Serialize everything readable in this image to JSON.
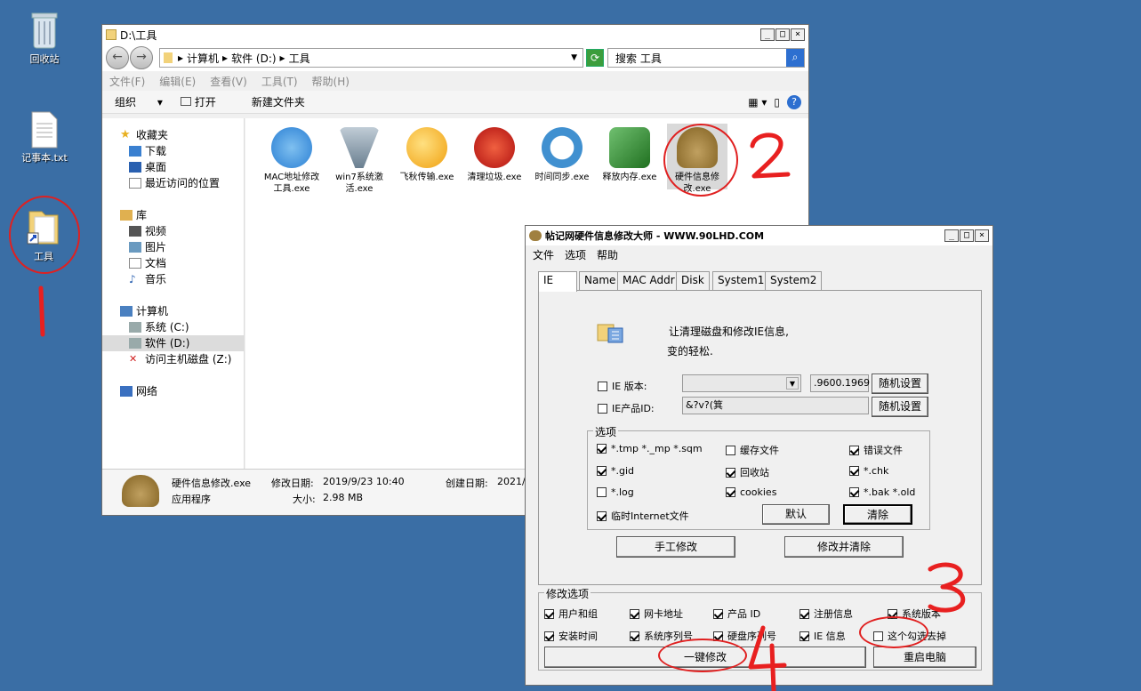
{
  "desktop": {
    "icons": [
      {
        "label": "回收站"
      },
      {
        "label": "记事本.txt"
      },
      {
        "label": "工具"
      }
    ]
  },
  "explorer": {
    "title": "D:\\工具",
    "breadcrumb": [
      "计算机",
      "软件 (D:)",
      "工具"
    ],
    "search_placeholder": "搜索 工具",
    "menu": [
      "文件(F)",
      "编辑(E)",
      "查看(V)",
      "工具(T)",
      "帮助(H)"
    ],
    "toolbar": {
      "organize": "组织",
      "open": "打开",
      "new_folder": "新建文件夹"
    },
    "nav": {
      "favorites": "收藏夹",
      "fav_items": [
        "下载",
        "桌面",
        "最近访问的位置"
      ],
      "libraries": "库",
      "lib_items": [
        "视频",
        "图片",
        "文档",
        "音乐"
      ],
      "computer": "计算机",
      "drives": [
        "系统 (C:)",
        "软件 (D:)",
        "访问主机磁盘 (Z:)"
      ],
      "network": "网络"
    },
    "files": [
      {
        "name": "MAC地址修改工具.exe",
        "color": "#2a7fd4"
      },
      {
        "name": "win7系统激活.exe",
        "color": "#7a8fa0"
      },
      {
        "name": "飞秋传输.exe",
        "color": "#f0b020"
      },
      {
        "name": "清理垃圾.exe",
        "color": "#d03020"
      },
      {
        "name": "时间同步.exe",
        "color": "#4090d0"
      },
      {
        "name": "释放内存.exe",
        "color": "#40a040"
      },
      {
        "name": "硬件信息修改.exe",
        "color": "#a08040"
      }
    ],
    "status": {
      "filename": "硬件信息修改.exe",
      "modified_label": "修改日期:",
      "modified": "2019/9/23 10:40",
      "created_label": "创建日期:",
      "created": "2021/",
      "type": "应用程序",
      "size_label": "大小:",
      "size": "2.98 MB"
    }
  },
  "tool": {
    "title": "帖记网硬件信息修改大师 - WWW.90LHD.COM",
    "menu": [
      "文件",
      "选项",
      "帮助"
    ],
    "tabs": [
      "IE",
      "Name",
      "MAC Addr",
      "Disk",
      "System1",
      "System2"
    ],
    "intro_line1": "让清理磁盘和修改IE信息,",
    "intro_line2": "变的轻松.",
    "ie_version_label": "IE 版本:",
    "ie_version_value": ".9600.1969",
    "ie_product_label": "IE产品ID:",
    "ie_product_value": "&?v?(箕",
    "random_btn": "随机设置",
    "options_legend": "选项",
    "options": [
      {
        "label": "*.tmp  *._mp  *.sqm",
        "checked": true
      },
      {
        "label": "缓存文件",
        "checked": false
      },
      {
        "label": "错误文件",
        "checked": true
      },
      {
        "label": "*.gid",
        "checked": true
      },
      {
        "label": "回收站",
        "checked": true
      },
      {
        "label": "*.chk",
        "checked": true
      },
      {
        "label": "*.log",
        "checked": false
      },
      {
        "label": "cookies",
        "checked": true
      },
      {
        "label": "*.bak  *.old",
        "checked": true
      },
      {
        "label": "临时Internet文件",
        "checked": true
      }
    ],
    "default_btn": "默认",
    "clear_btn": "清除",
    "manual_btn": "手工修改",
    "modify_clear_btn": "修改并清除",
    "modify_legend": "修改选项",
    "modify_options": [
      {
        "label": "用户和组",
        "checked": true
      },
      {
        "label": "网卡地址",
        "checked": true
      },
      {
        "label": "产品 ID",
        "checked": true
      },
      {
        "label": "注册信息",
        "checked": true
      },
      {
        "label": "系统版本",
        "checked": true
      },
      {
        "label": "安装时间",
        "checked": true
      },
      {
        "label": "系统序列号",
        "checked": true
      },
      {
        "label": "硬盘序列号",
        "checked": true
      },
      {
        "label": "IE 信息",
        "checked": true
      },
      {
        "label": "这个勾选去掉",
        "checked": false
      }
    ],
    "one_click_btn": "一键修改",
    "reboot_btn": "重启电脑"
  },
  "annotations": [
    "1",
    "2",
    "3",
    "4"
  ]
}
